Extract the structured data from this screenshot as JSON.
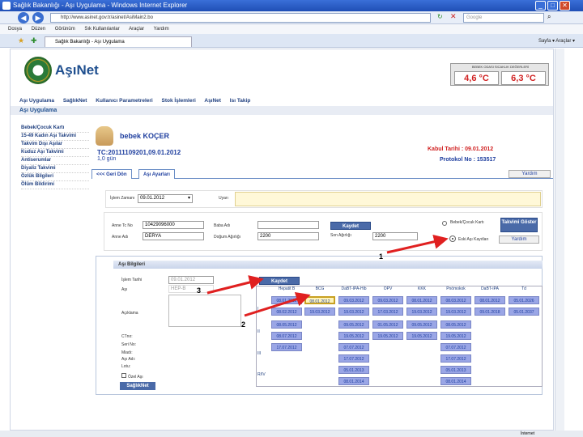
{
  "window": {
    "title": "Sağlık Bakanlığı - Aşı Uygulama - Windows Internet Explorer"
  },
  "browser": {
    "url": "http://www.asinet.gov.tr/asinet/AsiMain2.bo",
    "search_placeholder": "Google",
    "menu": [
      "Dosya",
      "Düzen",
      "Görünüm",
      "Sık Kullanılanlar",
      "Araçlar",
      "Yardım"
    ],
    "tab_label": "Sağlık Bakanlığı - Aşı Uygulama",
    "tools": "Sayfa ▾  Araçlar ▾"
  },
  "header": {
    "brand": "AşıNet",
    "temp_caption": "BEBEK ODASI SICAKLIK DEĞERLERİ",
    "temp_min": "4,6 °C",
    "temp_max": "6,3 °C"
  },
  "topnav": [
    "Aşı Uygulama",
    "SağlıkNet",
    "Kullanıcı Parametreleri",
    "Stok İşlemleri",
    "AşıNet",
    "Isı Takip"
  ],
  "module_title": "Aşı Uygulama",
  "leftmenu": [
    "Bebek/Çocuk Kartı",
    "15-49 Kadın Aşı Takvimi",
    "Takvim Dışı Aşılar",
    "Kuduz Aşı Takvimi",
    "Antiserumlar",
    "Diyaliz Takvimi",
    "Özlük Bilgileri",
    "Ölüm Bildirimi"
  ],
  "patient": {
    "name": "bebek KOÇER",
    "tc": "TC:20111109201,09.01.2012",
    "age": "1,0 gün",
    "kabul": "Kabul Tarihi : 09.01.2012",
    "protokol": "Protokol No : 153517"
  },
  "tabs": {
    "back": "<<< Geri Dön",
    "asi_ayarlari": "Aşı Ayarları",
    "help": "Yardım"
  },
  "islem": {
    "label": "İşlem Zamanı",
    "value": "09.01.2012",
    "uyari_label": "Uyarı"
  },
  "form": {
    "anne_tc_label": "Anne Tc No",
    "anne_tc": "10429096000",
    "anne_adi_label": "Anne Adı",
    "anne_adi": "DERYA",
    "baba_label": "Baba Adı",
    "baba": "",
    "dogum_label": "Doğum Ağırlığı",
    "dogum": "2200",
    "kaydet": "Kaydet",
    "son_agirlik_label": "Son Ağırlığı",
    "son_agirlik": "2200",
    "radio1": "Bebek/Çocuk Kartı",
    "radio2": "Eski Aşı Kayıtları",
    "takvim": "Takvimi Göster",
    "help": "Yardım"
  },
  "asi": {
    "header": "Aşı Bilgileri",
    "kaydet": "Kaydet",
    "islem_tarihi_label": "İşlem Tarihi",
    "islem_tarihi": "09.01.2012",
    "asi_label": "Aşı",
    "asi_value": "HEP-B",
    "aciklama_label": "Açıklama",
    "fields": [
      "CTno:",
      "Seri No:",
      "Miadı:",
      "Aşı Adı:",
      "Lotu:"
    ],
    "ozel_asi": "Özel Aşı",
    "sagliknet": "SağlıkNet",
    "columns": [
      "Hepatit B",
      "BCG",
      "DaBT-IPA-Hib",
      "OPV",
      "KKK",
      "Pnömokok",
      "DaBT-IPA",
      "Td"
    ],
    "rows": [
      "I",
      "II",
      "III",
      "R/IV"
    ],
    "cells": [
      [
        "08.01.2012",
        "08.01.2012",
        "09.03.2012",
        "09.03.2012",
        "08.01.2012",
        "08.03.2012",
        "08.01.2012",
        "05.01.2026"
      ],
      [
        "08.02.2012",
        "19.03.2012",
        "19.03.2012",
        "17.03.2012",
        "19.03.2012",
        "19.03.2012",
        "09.01.2018",
        "05.01.2037"
      ],
      [
        "08.05.2012",
        "",
        "09.05.2012",
        "01.05.2012",
        "09.05.2012",
        "08.05.2012",
        "",
        ""
      ],
      [
        "08.07.2012",
        "",
        "19.05.2012",
        "19.05.2012",
        "19.05.2012",
        "19.05.2012",
        "",
        ""
      ],
      [
        "17.07.2012",
        "",
        "07.07.2012",
        "",
        "",
        "07.07.2012",
        "",
        ""
      ],
      [
        "",
        "",
        "17.07.2012",
        "",
        "",
        "17.07.2012",
        "",
        ""
      ],
      [
        "",
        "",
        "05.01.2013",
        "",
        "",
        "05.01.2013",
        "",
        ""
      ],
      [
        "",
        "",
        "08.01.2014",
        "",
        "",
        "08.01.2014",
        "",
        ""
      ]
    ]
  },
  "annotations": {
    "n1": "1",
    "n2": "2",
    "n3": "3"
  },
  "status": "İnternet"
}
